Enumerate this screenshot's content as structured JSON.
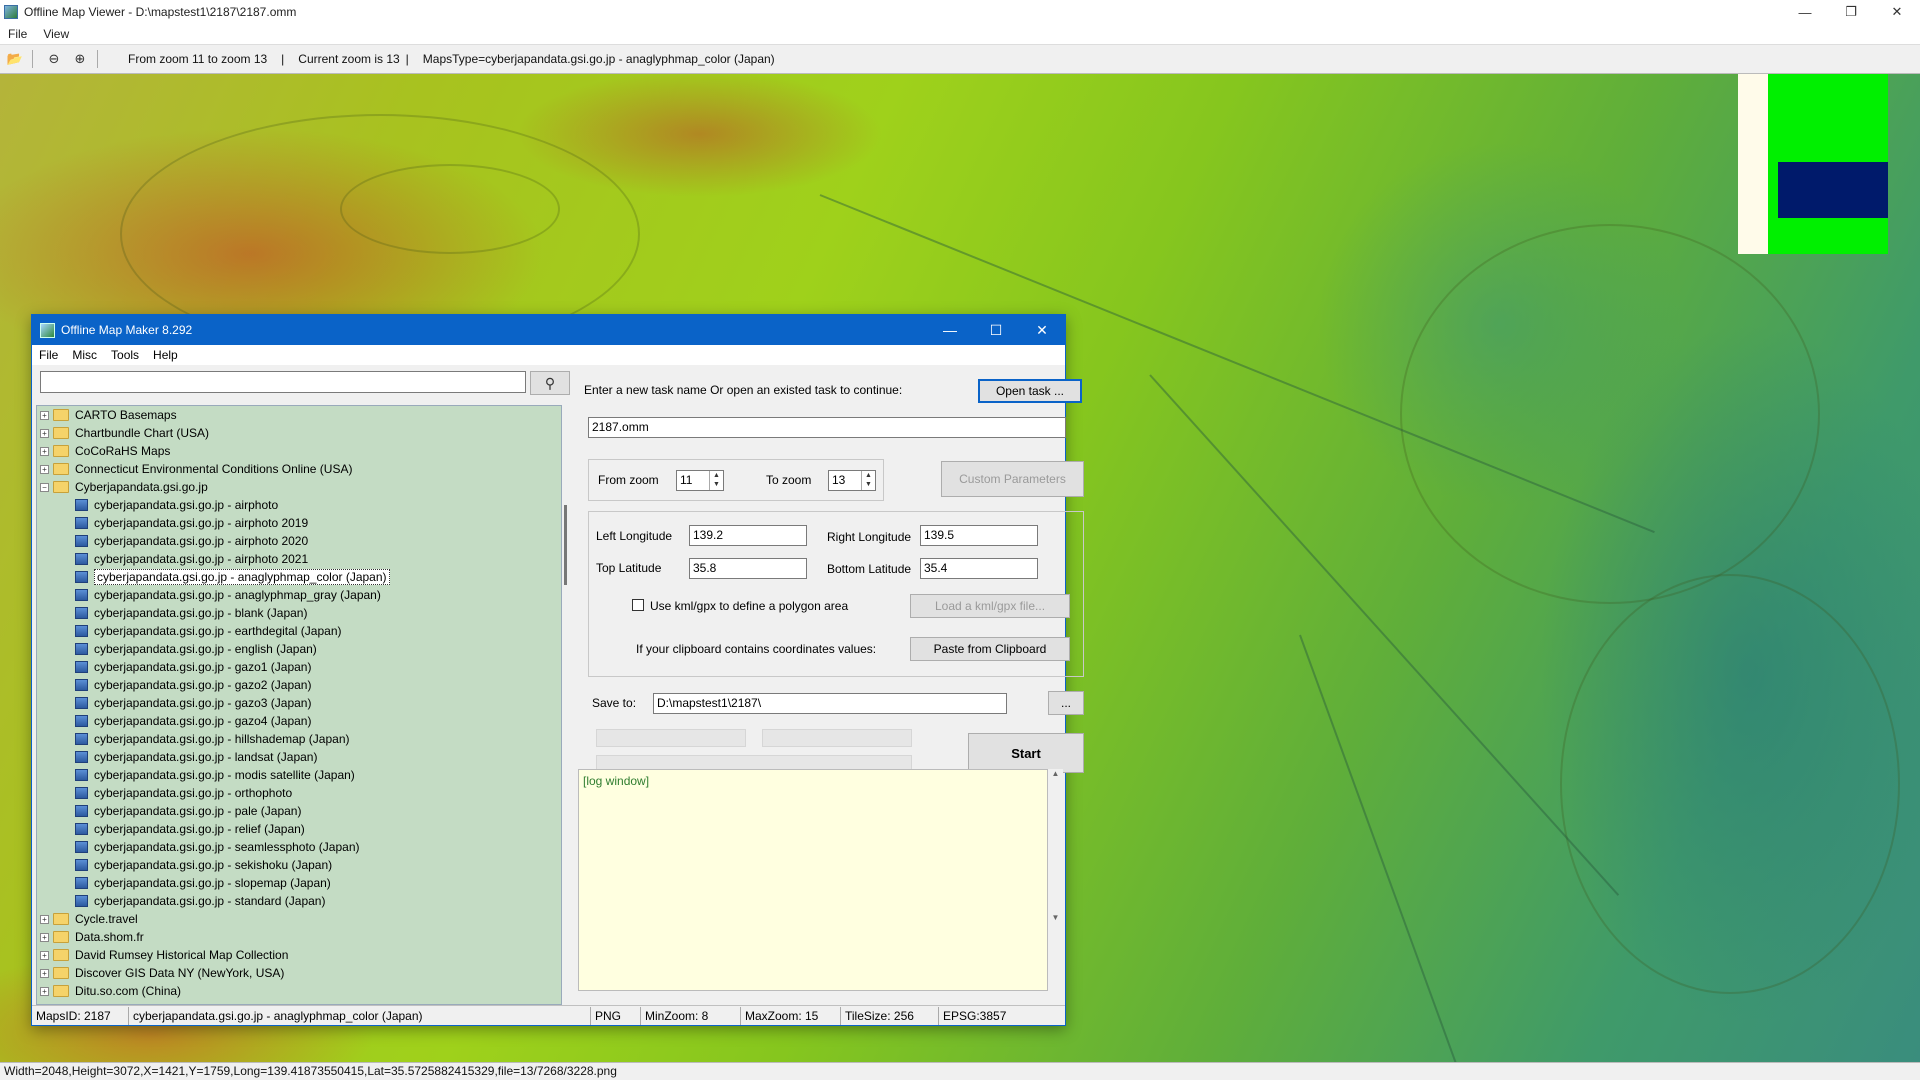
{
  "viewer": {
    "title": "Offline Map Viewer - D:\\mapstest1\\2187\\2187.omm",
    "menu": [
      "File",
      "View"
    ],
    "toolbar": {
      "zoom_range": "From zoom 11 to zoom 13",
      "sep1": "|",
      "current_zoom": "Current zoom is 13",
      "sep2": "|",
      "maps_type": "MapsType=cyberjapandata.gsi.go.jp - anaglyphmap_color (Japan)"
    },
    "status": "Width=2048,Height=3072,X=1421,Y=1759,Long=139.41873550415,Lat=35.5725882415329,file=13/7268/3228.png"
  },
  "dialog": {
    "title": "Offline Map Maker 8.292",
    "menu": [
      "File",
      "Misc",
      "Tools",
      "Help"
    ],
    "search": {
      "value": "",
      "placeholder": ""
    },
    "tree": {
      "folders_before": [
        "CARTO Basemaps",
        "Chartbundle Chart (USA)",
        "CoCoRaHS Maps",
        "Connecticut Environmental Conditions Online (USA)"
      ],
      "open_folder": "Cyberjapandata.gsi.go.jp",
      "children": [
        "cyberjapandata.gsi.go.jp - airphoto",
        "cyberjapandata.gsi.go.jp - airphoto 2019",
        "cyberjapandata.gsi.go.jp - airphoto 2020",
        "cyberjapandata.gsi.go.jp - airphoto 2021",
        "cyberjapandata.gsi.go.jp - anaglyphmap_color (Japan)",
        "cyberjapandata.gsi.go.jp - anaglyphmap_gray (Japan)",
        "cyberjapandata.gsi.go.jp - blank (Japan)",
        "cyberjapandata.gsi.go.jp - earthdegital (Japan)",
        "cyberjapandata.gsi.go.jp - english (Japan)",
        "cyberjapandata.gsi.go.jp - gazo1 (Japan)",
        "cyberjapandata.gsi.go.jp - gazo2 (Japan)",
        "cyberjapandata.gsi.go.jp - gazo3 (Japan)",
        "cyberjapandata.gsi.go.jp - gazo4 (Japan)",
        "cyberjapandata.gsi.go.jp - hillshademap (Japan)",
        "cyberjapandata.gsi.go.jp - landsat (Japan)",
        "cyberjapandata.gsi.go.jp - modis satellite (Japan)",
        "cyberjapandata.gsi.go.jp - orthophoto",
        "cyberjapandata.gsi.go.jp - pale (Japan)",
        "cyberjapandata.gsi.go.jp - relief (Japan)",
        "cyberjapandata.gsi.go.jp - seamlessphoto (Japan)",
        "cyberjapandata.gsi.go.jp - sekishoku (Japan)",
        "cyberjapandata.gsi.go.jp - slopemap (Japan)",
        "cyberjapandata.gsi.go.jp - standard (Japan)"
      ],
      "selected_index": 4,
      "folders_after": [
        "Cycle.travel",
        "Data.shom.fr",
        "David Rumsey Historical Map Collection",
        "Discover GIS Data NY (NewYork, USA)",
        "Ditu.so.com (China)"
      ]
    },
    "form": {
      "task_prompt": "Enter a new task name Or open an existed task to continue:",
      "open_task_label": "Open task ...",
      "task_name": "2187.omm",
      "from_zoom_label": "From zoom",
      "from_zoom_value": "11",
      "to_zoom_label": "To zoom",
      "to_zoom_value": "13",
      "custom_params_label": "Custom Parameters",
      "left_lon_label": "Left Longitude",
      "left_lon_value": "139.2",
      "right_lon_label": "Right Longitude",
      "right_lon_value": "139.5",
      "top_lat_label": "Top Latitude",
      "top_lat_value": "35.8",
      "bottom_lat_label": "Bottom Latitude",
      "bottom_lat_value": "35.4",
      "kml_checkbox_label": "Use kml/gpx to define a polygon area",
      "kml_checked": false,
      "load_kml_label": "Load a kml/gpx file...",
      "clipboard_label": "If your clipboard contains coordinates values:",
      "paste_label": "Paste from Clipboard",
      "save_to_label": "Save to:",
      "save_to_value": "D:\\mapstest1\\2187\\",
      "browse_label": "...",
      "start_label": "Start",
      "log_text": "[log window]"
    },
    "status": {
      "maps_id": "MapsID: 2187",
      "maps_name": "cyberjapandata.gsi.go.jp - anaglyphmap_color (Japan)",
      "format": "PNG",
      "min_zoom": "MinZoom: 8",
      "max_zoom": "MaxZoom: 15",
      "tile_size": "TileSize: 256",
      "epsg": "EPSG:3857"
    }
  },
  "colors": {
    "dialog_accent": "#0a63c8",
    "tree_background": "#c4dcc4",
    "log_background": "#ffffe0",
    "minimap_green": "#00f000",
    "minimap_navy": "#001a6b"
  }
}
